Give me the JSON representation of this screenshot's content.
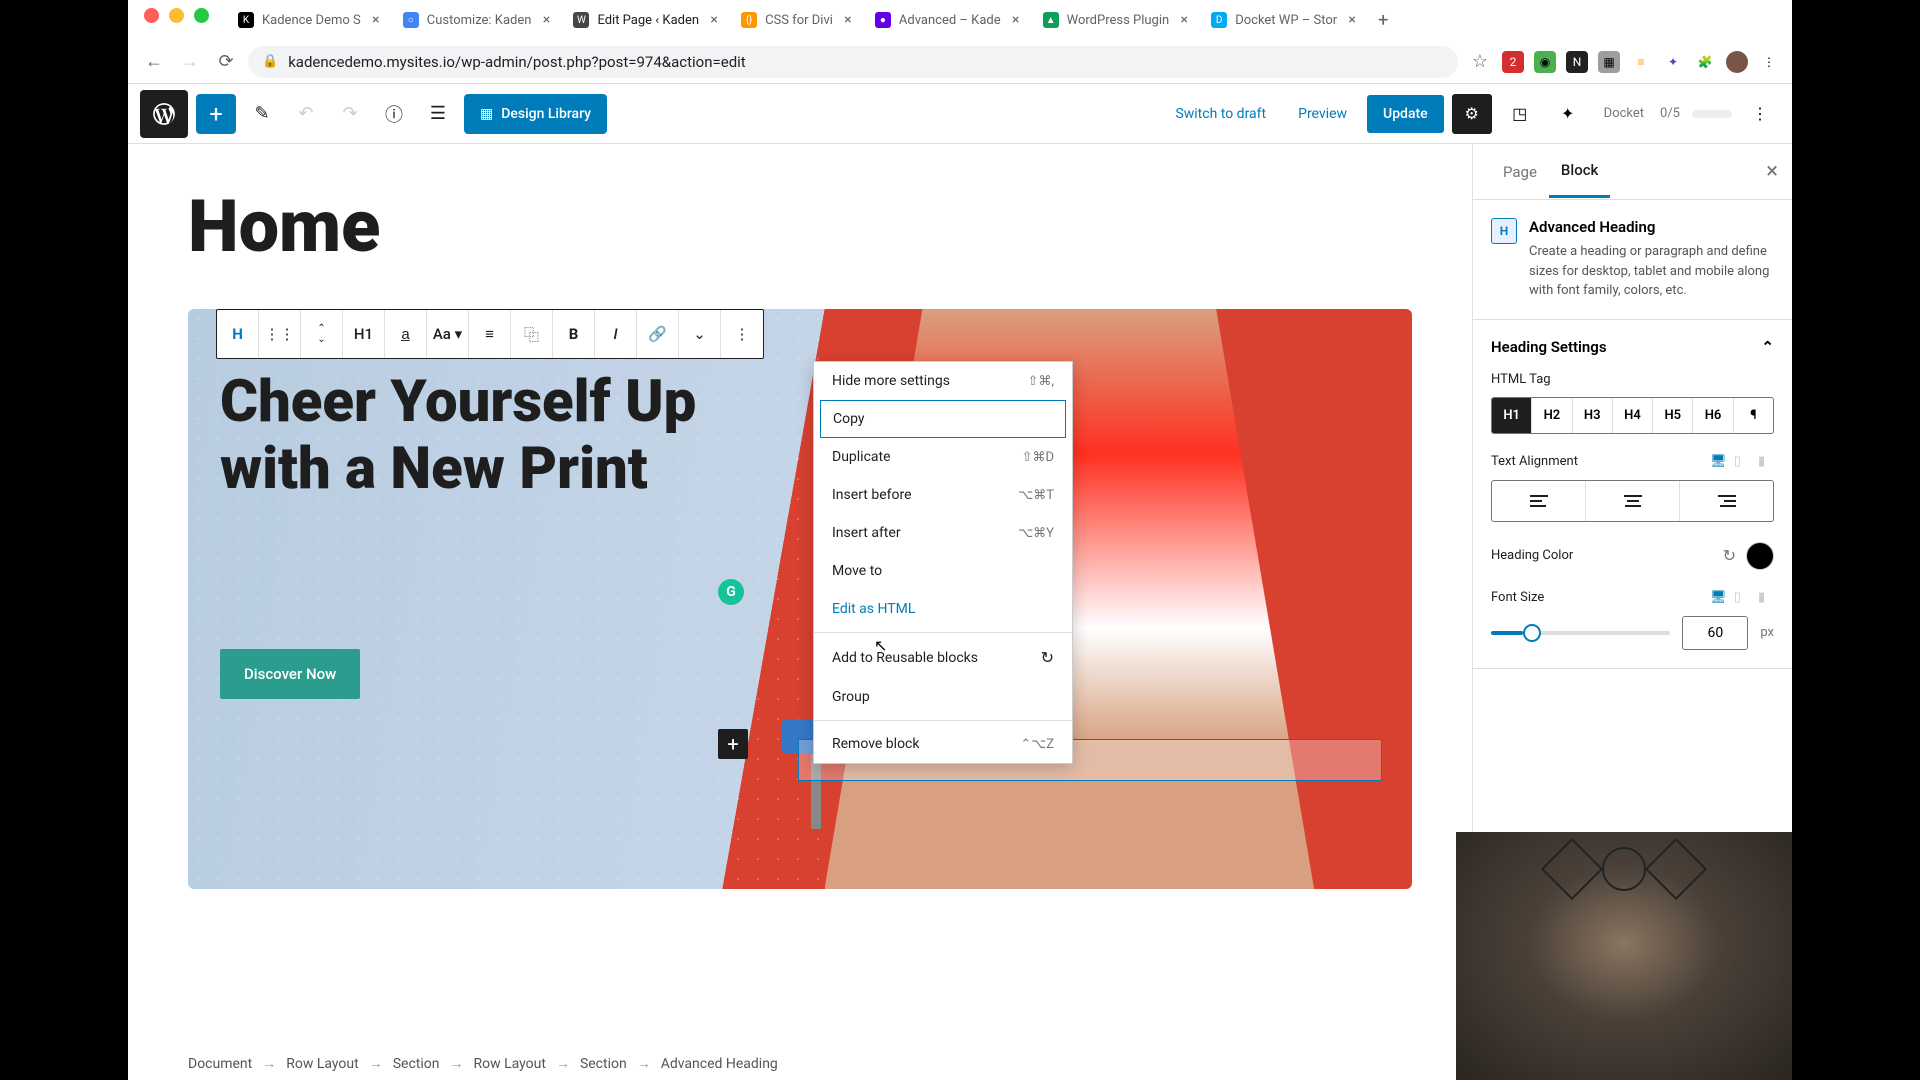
{
  "browser": {
    "tabs": [
      {
        "title": "Kadence Demo S",
        "favicon_bg": "#000",
        "favicon_text": "K"
      },
      {
        "title": "Customize: Kaden",
        "favicon_bg": "#4285f4",
        "favicon_text": "○"
      },
      {
        "title": "Edit Page ‹ Kaden",
        "favicon_bg": "#464646",
        "favicon_text": "W",
        "active": true
      },
      {
        "title": "CSS for Divi",
        "favicon_bg": "#ff9800",
        "favicon_text": "{}"
      },
      {
        "title": "Advanced – Kade",
        "favicon_bg": "#6200ea",
        "favicon_text": "●"
      },
      {
        "title": "WordPress Plugin",
        "favicon_bg": "#0f9d58",
        "favicon_text": "▲"
      },
      {
        "title": "Docket WP – Stor",
        "favicon_bg": "#03a9f4",
        "favicon_text": "D"
      }
    ],
    "url": "kadencedemo.mysites.io/wp-admin/post.php?post=974&action=edit"
  },
  "topbar": {
    "design_library": "Design Library",
    "switch_draft": "Switch to draft",
    "preview": "Preview",
    "update": "Update",
    "docket": "Docket",
    "docket_count": "0/5"
  },
  "canvas": {
    "page_title": "Home",
    "heading_text": "Cheer Yourself Up with a New Print",
    "button_text": "Discover Now",
    "toolbar_level": "H1"
  },
  "context_menu": {
    "items": [
      {
        "label": "Hide more settings",
        "shortcut": "⇧⌘,"
      },
      {
        "label": "Copy",
        "highlighted": true
      },
      {
        "label": "Duplicate",
        "shortcut": "⇧⌘D"
      },
      {
        "label": "Insert before",
        "shortcut": "⌥⌘T"
      },
      {
        "label": "Insert after",
        "shortcut": "⌥⌘Y"
      },
      {
        "label": "Move to"
      },
      {
        "label": "Edit as HTML",
        "link_style": true
      }
    ],
    "group2": [
      {
        "label": "Add to Reusable blocks",
        "has_icon": true
      },
      {
        "label": "Group"
      }
    ],
    "group3": [
      {
        "label": "Remove block",
        "shortcut": "⌃⌥Z"
      }
    ]
  },
  "sidebar": {
    "tab_page": "Page",
    "tab_block": "Block",
    "block_name": "Advanced Heading",
    "block_desc": "Create a heading or paragraph and define sizes for desktop, tablet and mobile along with font family, colors, etc.",
    "heading_settings": "Heading Settings",
    "html_tag_label": "HTML Tag",
    "tags": [
      "H1",
      "H2",
      "H3",
      "H4",
      "H5",
      "H6",
      "¶"
    ],
    "text_align_label": "Text Alignment",
    "heading_color_label": "Heading Color",
    "font_size_label": "Font Size",
    "font_size_value": "60",
    "font_size_unit": "px"
  },
  "breadcrumb": [
    "Document",
    "Row Layout",
    "Section",
    "Row Layout",
    "Section",
    "Advanced Heading"
  ]
}
